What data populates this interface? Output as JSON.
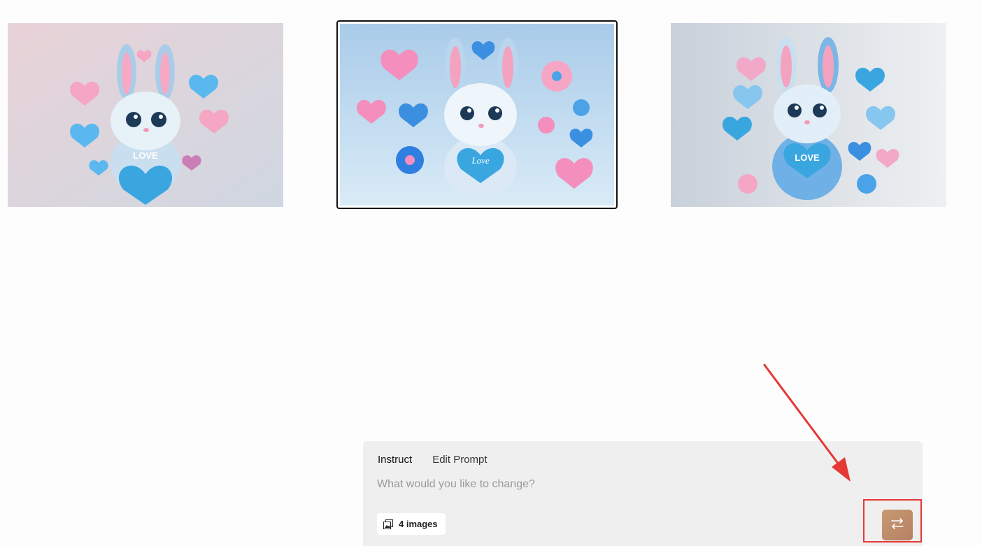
{
  "gallery": {
    "images": [
      {
        "heart_text": "LOVE"
      },
      {
        "heart_text": "Love"
      },
      {
        "heart_text": "LOVE"
      }
    ]
  },
  "panel": {
    "tabs": [
      {
        "label": "Instruct"
      },
      {
        "label": "Edit Prompt"
      }
    ],
    "input": {
      "value": "",
      "placeholder": "What would you like to change?"
    },
    "images_button": {
      "label": "4 images",
      "icon": "images-stack-icon"
    },
    "generate_button": {
      "icon": "repeat-icon"
    }
  },
  "annotation": {
    "color": "#e53935"
  }
}
